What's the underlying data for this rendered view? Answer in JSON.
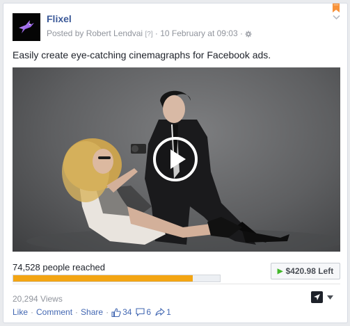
{
  "post": {
    "page_name": "Flixel",
    "posted_by": "Posted by Robert Lendvai",
    "qmark": "[?]",
    "timestamp": "10 February at 09:03",
    "dot1": "·",
    "dot2": "·",
    "text": "Easily create eye-catching cinemagraphs for Facebook ads."
  },
  "reach": {
    "people_reached": "74,528 people reached",
    "budget_left": "$420.98 Left",
    "progress_fraction": 0.87
  },
  "stats": {
    "views": "20,294 Views",
    "likes": "34",
    "comments": "6",
    "shares": "1"
  },
  "actions": {
    "like": "Like",
    "comment": "Comment",
    "share": "Share",
    "sep": "·"
  },
  "icons": {
    "logo": "hummingbird-logo-icon",
    "gear": "gear-icon",
    "play": "play-icon",
    "thumb": "thumbs-up-icon",
    "comment": "comment-bubble-icon",
    "share": "share-arrow-icon",
    "bookmark": "bookmark-ribbon-icon",
    "menu": "chevron-down-icon"
  },
  "colors": {
    "link": "#3b5998",
    "progress": "#f3a513",
    "budget_play": "#42b72a"
  }
}
